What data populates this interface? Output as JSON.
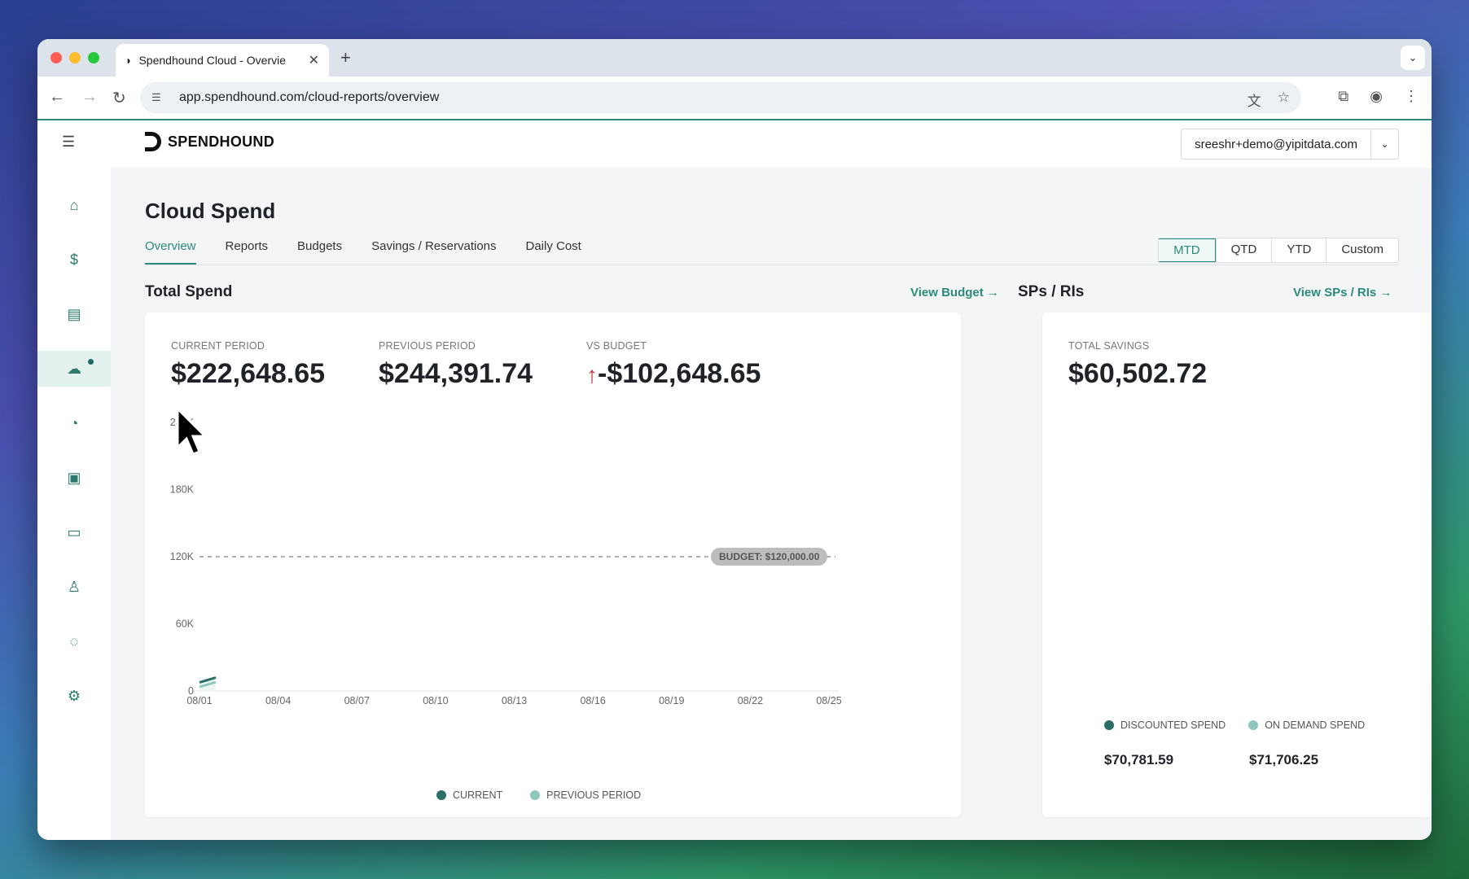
{
  "browser": {
    "tab_title": "Spendhound Cloud - Overvie",
    "url": "app.spendhound.com/cloud-reports/overview"
  },
  "app": {
    "brand": "SPENDHOUND",
    "user_email": "sreeshr+demo@yipitdata.com",
    "sidebar_icons": [
      "home-icon",
      "dollar-icon",
      "invoice-icon",
      "cloud-icon",
      "pie-chart-icon",
      "receipt-icon",
      "folder-icon",
      "user-icon",
      "chat-icon",
      "gear-icon"
    ],
    "active_sidebar": "cloud-icon"
  },
  "page": {
    "title": "Cloud Spend",
    "tabs": [
      "Overview",
      "Reports",
      "Budgets",
      "Savings / Reservations",
      "Daily Cost"
    ],
    "active_tab": "Overview",
    "periods": [
      "MTD",
      "QTD",
      "YTD",
      "Custom"
    ],
    "active_period": "MTD"
  },
  "total_spend": {
    "title": "Total Spend",
    "link": "View Budget",
    "current_label": "CURRENT PERIOD",
    "current_value": "$222,648.65",
    "previous_label": "PREVIOUS PERIOD",
    "previous_value": "$244,391.74",
    "budget_label": "VS BUDGET",
    "budget_value": "-$102,648.65",
    "budget_pill": "BUDGET: $120,000.00",
    "legend_current": "CURRENT",
    "legend_previous": "PREVIOUS PERIOD"
  },
  "sps": {
    "title": "SPs / RIs",
    "link": "View SPs / RIs",
    "savings_label": "TOTAL SAVINGS",
    "savings_value": "$60,502.72",
    "legend_discounted": "DISCOUNTED SPEND",
    "legend_ondemand": "ON DEMAND SPEND",
    "discounted_value": "$70,781.59",
    "ondemand_value": "$71,706.25"
  },
  "colors": {
    "accent": "#2b8a7a",
    "current": "#2b6e66",
    "previous": "#8fc7bd",
    "negative": "#c8303a"
  },
  "chart_data": {
    "type": "area",
    "x": [
      "08/01",
      "08/04",
      "08/07",
      "08/10",
      "08/13",
      "08/16",
      "08/19",
      "08/22",
      "08/25"
    ],
    "y_ticks": [
      "0",
      "60K",
      "120K",
      "180K",
      "240K"
    ],
    "ylim": [
      0,
      240000
    ],
    "budget_line": 120000,
    "series": [
      {
        "name": "CURRENT",
        "points": [
          [
            "08/01",
            12000
          ]
        ]
      },
      {
        "name": "PREVIOUS PERIOD",
        "points": [
          [
            "08/01",
            8000
          ]
        ]
      }
    ],
    "legend": "bottom-center"
  }
}
